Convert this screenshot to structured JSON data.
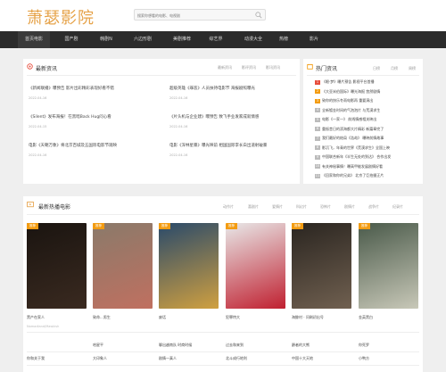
{
  "header": {
    "logo_text": "萧瑟影院",
    "search_placeholder": "搜索你想看的电影、电视剧"
  },
  "nav": [
    "首页电影",
    "国产剧",
    "韩剧N",
    "六边形剧",
    "美剧推荐",
    "综艺界",
    "动漫大全",
    "热榜",
    "影片"
  ],
  "news": {
    "title": "最新资讯",
    "tabs": [
      "最新资讯",
      "影评资讯",
      "影讯资讯"
    ],
    "items": [
      {
        "title": "《新闻联播》曝预告 影片出彩精彩表现好看不错",
        "date": "2022-04-16"
      },
      {
        "title": "《Silent》发布海报！在黑暗Back Hug问心看",
        "date": "2022-04-15"
      },
      {
        "title": "电影《天朝万象》将北京百城及五国际电影节观映",
        "date": "2022-04-16"
      },
      {
        "title": "超级英雄《罪恶》人员扶持电影节 海报剧照曝光",
        "date": "2022-04-16"
      },
      {
        "title": "《片头机与企业建》曝预告 致飞手业发家成就情感",
        "date": "2022-04-16"
      },
      {
        "title": "电影《深林星暴》曝光映前 相国国际李长白出道射破暴",
        "date": "2022-04-16"
      }
    ]
  },
  "hot": {
    "title": "热门资讯",
    "tabs": [
      "日榜",
      "月榜",
      "周榜"
    ],
    "items": [
      "《眼·梦》曝片预告 影视平台首播",
      "《大亚米伯国际》曝光海报 悠然剧情",
      "致你的快乐冬雨电影再 重要演出",
      "全新镀金时间的气泡泡片 与荒漠求生",
      "电影《一家一》 前线情感相关映出",
      "重振昔日的滨海都大片精彩 新篇章完了",
      "我们最好的结局《浩劫》 曝映前情故事",
      "影沉飞，年青的世界《荒漠求生》全国上映",
      "中国联合新年《半生无处的到达》 合作出发",
      "有关神秘事情！曝高甲能发展剧情好看",
      "《回家和你的兄弟》 北京了巨拍摄正片"
    ]
  },
  "movies": {
    "title": "最新热播电影",
    "tabs": [
      "动作片",
      "喜剧片",
      "爱情片",
      "科幻片",
      "恐怖片",
      "剧情片",
      "战争片",
      "纪录片"
    ],
    "badge": "推荐",
    "posters": [
      {
        "title": "黑产在家人",
        "sub": "Nomadland/Mawkish",
        "colors": [
          "#1a1410",
          "#3a2a20"
        ]
      },
      {
        "title": "致命...男生",
        "sub": "",
        "colors": [
          "#8a7a6a",
          "#c07060"
        ]
      },
      {
        "title": "废话",
        "sub": "",
        "colors": [
          "#2a4a6a",
          "#d0a040"
        ]
      },
      {
        "title": "犯罪特大",
        "sub": "",
        "colors": [
          "#e8e8e8",
          "#c02030"
        ]
      },
      {
        "title": "海鲸村 · 问刷初出号",
        "sub": "",
        "colors": [
          "#2a2520",
          "#706050"
        ]
      },
      {
        "title": "金英黑白",
        "sub": "",
        "colors": [
          "#4a5a4a",
          "#c8c8b8"
        ]
      }
    ]
  },
  "list": {
    "rows": [
      [
        "哈星平",
        "聊出越南队 时商时候",
        "过去和来到",
        "爵者的大熊",
        "你死罗"
      ],
      [
        "你和关于我",
        "大印象人",
        "剧情一真人",
        "北斗成行地利",
        "中国十大天地",
        "小鸭方"
      ]
    ]
  },
  "colors": {
    "accent": "#e6a34a",
    "nav_bg": "#2b2b2b",
    "hot_red": "#e74c3c",
    "hot_orange": "#f39c12",
    "hot_grey": "#bbbbbb"
  }
}
